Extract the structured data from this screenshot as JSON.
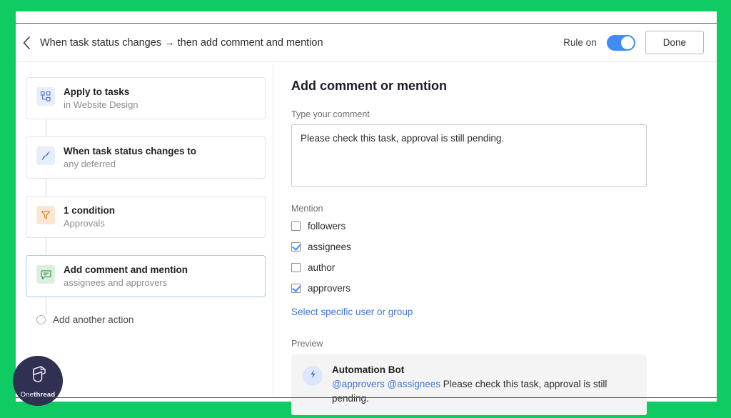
{
  "theme": {
    "frame_green": "#0ecb63",
    "accent_blue": "#3f8cf4",
    "link_blue": "#3f76d6",
    "logo_navy": "#2f3052"
  },
  "header": {
    "back_icon": "chevron-left-icon",
    "title": "When task status changes → then add comment and mention",
    "rule_toggle_label": "Rule on",
    "rule_toggle_state": "on",
    "done_label": "Done"
  },
  "flow": {
    "cards": [
      {
        "title": "Apply to tasks",
        "subtitle": "in Website Design",
        "icon": "task-board-icon",
        "icon_style": "blue",
        "selected": false
      },
      {
        "title": "When task status changes to",
        "subtitle": "any deferred",
        "icon": "trigger-path-icon",
        "icon_style": "blue",
        "selected": false
      },
      {
        "title": "1 condition",
        "subtitle": "Approvals",
        "icon": "filter-funnel-icon",
        "icon_style": "orange",
        "selected": false
      },
      {
        "title": "Add comment and mention",
        "subtitle": "assignees and approvers",
        "icon": "comment-bubble-icon",
        "icon_style": "green",
        "selected": true
      }
    ],
    "add_another_label": "Add another action"
  },
  "panel": {
    "heading": "Add comment or mention",
    "comment_label": "Type your comment",
    "comment_value": "Please check this task, approval is still pending.",
    "comment_placeholder": "Type your comment",
    "mention_label": "Mention",
    "mention_options": [
      {
        "label": "followers",
        "checked": false
      },
      {
        "label": "assignees",
        "checked": true
      },
      {
        "label": "author",
        "checked": false
      },
      {
        "label": "approvers",
        "checked": true
      }
    ],
    "select_user_link": "Select specific user or group",
    "preview_label": "Preview",
    "preview": {
      "avatar_icon": "lightning-bolt-icon",
      "bot_name": "Automation Bot",
      "mention_1": "@approvers",
      "mention_2": "@assignees",
      "message": "Please check this task, approval is still pending."
    }
  },
  "logo": {
    "icon": "onethread-cube-icon",
    "word_light": "One",
    "word_bold": "thread"
  }
}
